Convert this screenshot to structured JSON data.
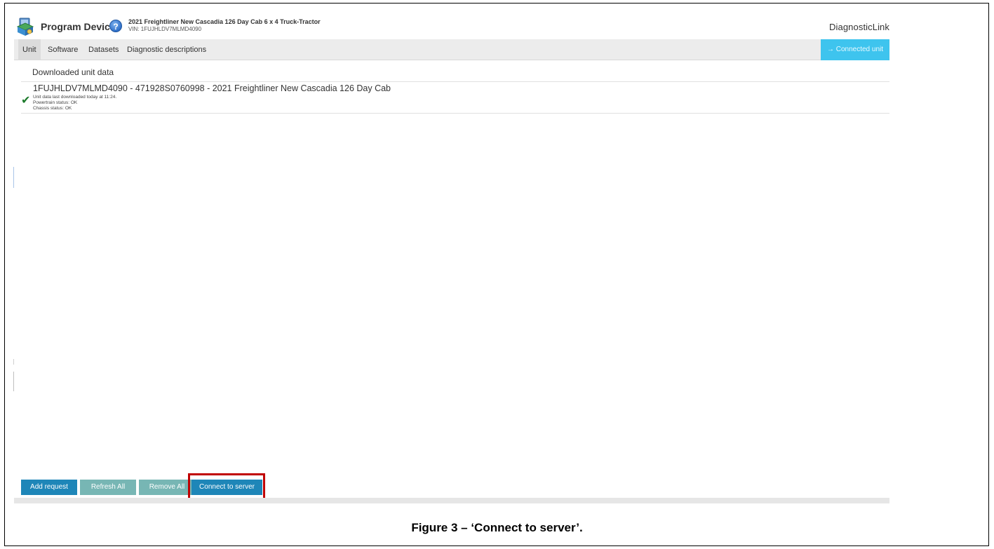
{
  "header": {
    "title": "Program Device",
    "vehicle_name": "2021 Freightliner New Cascadia 126 Day Cab 6 x 4 Truck-Tractor",
    "vin": "VIN: 1FUJHLDV7MLMD4090",
    "brand": "DiagnosticLink"
  },
  "tabs": [
    {
      "label": "Unit",
      "active": true
    },
    {
      "label": "Software",
      "active": false
    },
    {
      "label": "Datasets",
      "active": false
    },
    {
      "label": "Diagnostic descriptions",
      "active": false
    }
  ],
  "connected_unit_label": "→ Connected unit",
  "content": {
    "section_title": "Downloaded unit data",
    "unit": {
      "heading": "1FUJHLDV7MLMD4090 - 471928S0760998 - 2021 Freightliner New Cascadia 126 Day Cab",
      "last_download": "Unit data last downloaded today at 11:24.",
      "powertrain_status": "Powertrain status: OK",
      "chassis_status": "Chassis status: OK",
      "status_icon": "check-icon"
    }
  },
  "toolbar": {
    "add_request": "Add request",
    "refresh_all": "Refresh All",
    "remove_all": "Remove All",
    "connect_to_server": "Connect to server"
  },
  "caption": "Figure 3 – ‘Connect to server’.",
  "colors": {
    "primary_button": "#1e86b8",
    "disabled_button": "#77b6b4",
    "connected_unit": "#3ec4ee",
    "highlight": "#c00000",
    "check": "#1c7a2b"
  }
}
